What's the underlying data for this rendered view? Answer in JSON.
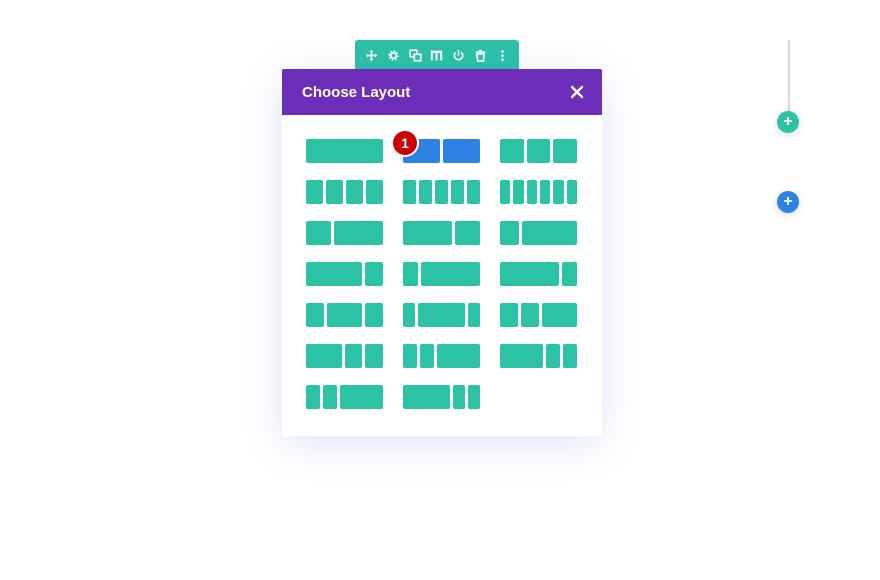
{
  "colors": {
    "accent": "#2cc2a6",
    "header": "#6c2eb9",
    "selected": "#2e82e4",
    "badge": "#cc0000",
    "add_row": "#2e82e4"
  },
  "toolbar": {
    "icons": [
      "move-icon",
      "gear-icon",
      "duplicate-icon",
      "columns-icon",
      "power-icon",
      "trash-icon",
      "more-icon"
    ]
  },
  "modal": {
    "title": "Choose Layout",
    "close_icon": "close-icon"
  },
  "badge": {
    "number": "1"
  },
  "layouts": [
    [
      [
        4
      ]
    ],
    [
      [
        2,
        2
      ]
    ],
    [
      [
        1,
        1,
        1
      ]
    ],
    [
      [
        1,
        1,
        1,
        1
      ]
    ],
    [
      [
        1,
        1,
        1,
        1,
        1
      ]
    ],
    [
      [
        1,
        1,
        1,
        1,
        1,
        1
      ]
    ],
    [
      [
        1,
        2
      ]
    ],
    [
      [
        2,
        1
      ]
    ],
    [
      [
        1,
        3
      ]
    ],
    [
      [
        3,
        1
      ]
    ],
    [
      [
        1,
        4
      ]
    ],
    [
      [
        4,
        1
      ]
    ],
    [
      [
        1,
        2,
        1
      ]
    ],
    [
      [
        1,
        4,
        1
      ]
    ],
    [
      [
        1,
        1,
        2
      ]
    ],
    [
      [
        2,
        1,
        1
      ]
    ],
    [
      [
        1,
        1,
        3
      ]
    ],
    [
      [
        3,
        1,
        1
      ]
    ],
    [
      [
        1,
        1,
        3
      ]
    ],
    [
      [
        4,
        1,
        1
      ]
    ]
  ],
  "selected_layout": 1,
  "add_buttons": [
    {
      "name": "add-section-button",
      "symbol": "+",
      "color": "#2cc2a6"
    },
    {
      "name": "add-row-button",
      "symbol": "+",
      "color": "#2e82e4"
    }
  ]
}
